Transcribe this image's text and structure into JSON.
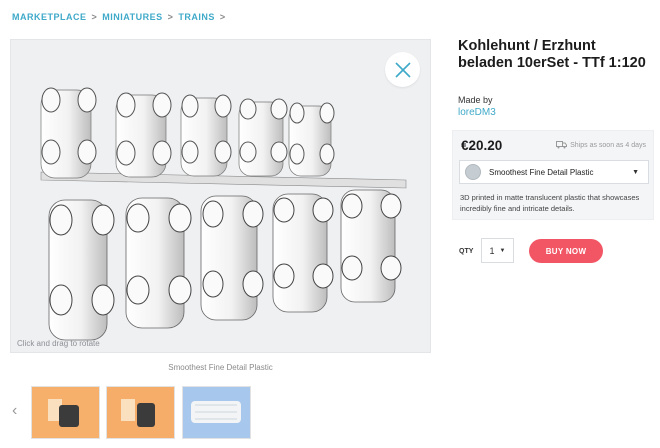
{
  "breadcrumb": [
    "MARKETPLACE",
    "MINIATURES",
    "TRAINS"
  ],
  "viewer": {
    "hint": "Click and drag to rotate",
    "close_icon": "close-icon"
  },
  "material_caption": "Smoothest Fine Detail Plastic",
  "thumbnails": {
    "prev_icon": "chevron-left-icon",
    "colors": [
      "#f7b06b",
      "#f6ad6a",
      "#a7c8ec"
    ]
  },
  "product": {
    "title": "Kohlehunt / Erzhunt beladen 10erSet - TTf 1:120",
    "made_by_label": "Made by",
    "author": "loreDM3",
    "price": "€20.20",
    "ships": "Ships as soon as 4 days",
    "ships_icon": "truck-icon",
    "material": "Smoothest Fine Detail Plastic",
    "material_swatch_color": "#c5cdd2",
    "description": "3D printed in matte translucent plastic that showcases incredibly fine and intricate details.",
    "qty_label": "QTY",
    "qty_value": "1",
    "buy_label": "BUY NOW",
    "buy_color": "#f25665",
    "accent_color": "#3fa9c9"
  }
}
